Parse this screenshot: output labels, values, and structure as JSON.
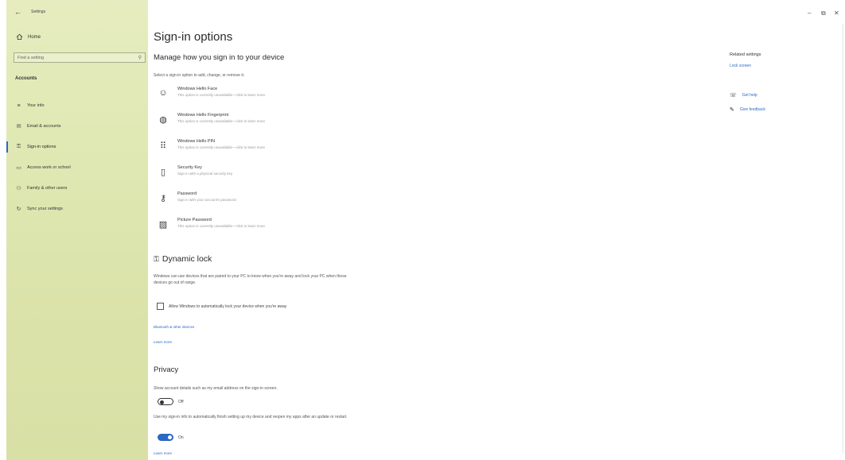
{
  "window": {
    "title": "Settings",
    "minimize": "–",
    "restore": "⧉",
    "close": "✕"
  },
  "sidebar": {
    "back": "←",
    "home": "Home",
    "search_placeholder": "Find a setting",
    "section": "Accounts",
    "items": [
      {
        "icon": "≡",
        "label": "Your info"
      },
      {
        "icon": "✉",
        "label": "Email & accounts"
      },
      {
        "icon": "🔑",
        "label": "Sign-in options"
      },
      {
        "icon": "▭",
        "label": "Access work or school"
      },
      {
        "icon": "⚇",
        "label": "Family & other users"
      },
      {
        "icon": "↻",
        "label": "Sync your settings"
      }
    ],
    "active_index": 2
  },
  "main": {
    "title": "Sign-in options",
    "subtitle": "Manage how you sign in to your device",
    "select_text": "Select a sign-in option to add, change, or remove it.",
    "options": [
      {
        "icon": "☺",
        "title": "Windows Hello Face",
        "desc": "This option is currently unavailable—click to learn more"
      },
      {
        "icon": "◍",
        "title": "Windows Hello Fingerprint",
        "desc": "This option is currently unavailable—click to learn more"
      },
      {
        "icon": "⠿",
        "title": "Windows Hello PIN",
        "desc": "This option is currently unavailable—click to learn more"
      },
      {
        "icon": "▯",
        "title": "Security Key",
        "desc": "Sign in with a physical security key"
      },
      {
        "icon": "⚷",
        "title": "Password",
        "desc": "Sign in with your account's password"
      },
      {
        "icon": "▨",
        "title": "Picture Password",
        "desc": "This option is currently unavailable—click to learn more"
      }
    ],
    "dynamic_lock": {
      "title": "Dynamic lock",
      "desc": "Windows can use devices that are paired to your PC to know when you're away and lock your PC when those devices go out of range.",
      "checkbox": "Allow Windows to automatically lock your device when you're away",
      "link1": "Bluetooth & other devices",
      "link2": "Learn more"
    },
    "privacy": {
      "title": "Privacy",
      "desc1": "Show account details such as my email address on the sign-in screen.",
      "toggle1": "Off",
      "desc2": "Use my sign-in info to automatically finish setting up my device and reopen my apps after an update or restart.",
      "toggle2": "On",
      "link": "Learn more"
    }
  },
  "related": {
    "heading": "Related settings",
    "lock_screen": "Lock screen",
    "get_help": "Get help",
    "give_feedback": "Give feedback"
  },
  "colors": {
    "accent": "#2a69c4",
    "sidebar": "#dfe8b2"
  }
}
